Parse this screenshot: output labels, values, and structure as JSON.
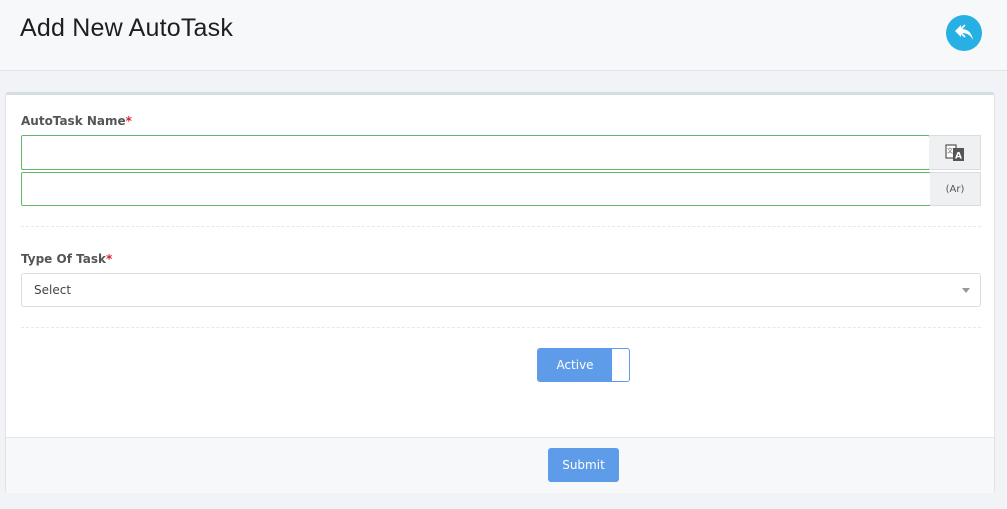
{
  "header": {
    "title": "Add New AutoTask",
    "back_icon": "reply-back-icon",
    "accent": "#26b0e4"
  },
  "form": {
    "name_label": "AutoTask Name",
    "required_mark": "*",
    "name_en_value": "",
    "translate_icon": "translate-icon",
    "name_ar_value": "",
    "ar_addon": "(Ar)",
    "type_label": "Type Of Task",
    "type_selected": "Select",
    "toggle_label": "Active",
    "toggle_state": true,
    "toggle_color": "#5e9be8"
  },
  "footer": {
    "submit_label": "Submit"
  }
}
